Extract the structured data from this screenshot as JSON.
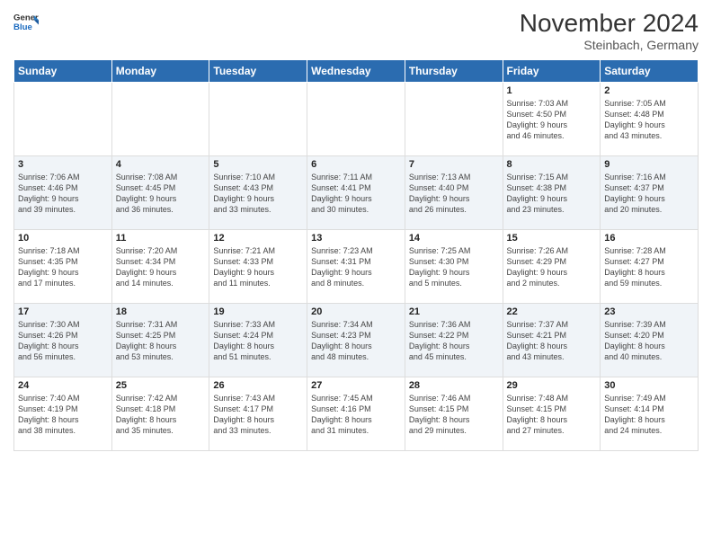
{
  "header": {
    "logo_line1": "General",
    "logo_line2": "Blue",
    "month_title": "November 2024",
    "subtitle": "Steinbach, Germany"
  },
  "weekdays": [
    "Sunday",
    "Monday",
    "Tuesday",
    "Wednesday",
    "Thursday",
    "Friday",
    "Saturday"
  ],
  "weeks": [
    [
      {
        "day": "",
        "info": ""
      },
      {
        "day": "",
        "info": ""
      },
      {
        "day": "",
        "info": ""
      },
      {
        "day": "",
        "info": ""
      },
      {
        "day": "",
        "info": ""
      },
      {
        "day": "1",
        "info": "Sunrise: 7:03 AM\nSunset: 4:50 PM\nDaylight: 9 hours\nand 46 minutes."
      },
      {
        "day": "2",
        "info": "Sunrise: 7:05 AM\nSunset: 4:48 PM\nDaylight: 9 hours\nand 43 minutes."
      }
    ],
    [
      {
        "day": "3",
        "info": "Sunrise: 7:06 AM\nSunset: 4:46 PM\nDaylight: 9 hours\nand 39 minutes."
      },
      {
        "day": "4",
        "info": "Sunrise: 7:08 AM\nSunset: 4:45 PM\nDaylight: 9 hours\nand 36 minutes."
      },
      {
        "day": "5",
        "info": "Sunrise: 7:10 AM\nSunset: 4:43 PM\nDaylight: 9 hours\nand 33 minutes."
      },
      {
        "day": "6",
        "info": "Sunrise: 7:11 AM\nSunset: 4:41 PM\nDaylight: 9 hours\nand 30 minutes."
      },
      {
        "day": "7",
        "info": "Sunrise: 7:13 AM\nSunset: 4:40 PM\nDaylight: 9 hours\nand 26 minutes."
      },
      {
        "day": "8",
        "info": "Sunrise: 7:15 AM\nSunset: 4:38 PM\nDaylight: 9 hours\nand 23 minutes."
      },
      {
        "day": "9",
        "info": "Sunrise: 7:16 AM\nSunset: 4:37 PM\nDaylight: 9 hours\nand 20 minutes."
      }
    ],
    [
      {
        "day": "10",
        "info": "Sunrise: 7:18 AM\nSunset: 4:35 PM\nDaylight: 9 hours\nand 17 minutes."
      },
      {
        "day": "11",
        "info": "Sunrise: 7:20 AM\nSunset: 4:34 PM\nDaylight: 9 hours\nand 14 minutes."
      },
      {
        "day": "12",
        "info": "Sunrise: 7:21 AM\nSunset: 4:33 PM\nDaylight: 9 hours\nand 11 minutes."
      },
      {
        "day": "13",
        "info": "Sunrise: 7:23 AM\nSunset: 4:31 PM\nDaylight: 9 hours\nand 8 minutes."
      },
      {
        "day": "14",
        "info": "Sunrise: 7:25 AM\nSunset: 4:30 PM\nDaylight: 9 hours\nand 5 minutes."
      },
      {
        "day": "15",
        "info": "Sunrise: 7:26 AM\nSunset: 4:29 PM\nDaylight: 9 hours\nand 2 minutes."
      },
      {
        "day": "16",
        "info": "Sunrise: 7:28 AM\nSunset: 4:27 PM\nDaylight: 8 hours\nand 59 minutes."
      }
    ],
    [
      {
        "day": "17",
        "info": "Sunrise: 7:30 AM\nSunset: 4:26 PM\nDaylight: 8 hours\nand 56 minutes."
      },
      {
        "day": "18",
        "info": "Sunrise: 7:31 AM\nSunset: 4:25 PM\nDaylight: 8 hours\nand 53 minutes."
      },
      {
        "day": "19",
        "info": "Sunrise: 7:33 AM\nSunset: 4:24 PM\nDaylight: 8 hours\nand 51 minutes."
      },
      {
        "day": "20",
        "info": "Sunrise: 7:34 AM\nSunset: 4:23 PM\nDaylight: 8 hours\nand 48 minutes."
      },
      {
        "day": "21",
        "info": "Sunrise: 7:36 AM\nSunset: 4:22 PM\nDaylight: 8 hours\nand 45 minutes."
      },
      {
        "day": "22",
        "info": "Sunrise: 7:37 AM\nSunset: 4:21 PM\nDaylight: 8 hours\nand 43 minutes."
      },
      {
        "day": "23",
        "info": "Sunrise: 7:39 AM\nSunset: 4:20 PM\nDaylight: 8 hours\nand 40 minutes."
      }
    ],
    [
      {
        "day": "24",
        "info": "Sunrise: 7:40 AM\nSunset: 4:19 PM\nDaylight: 8 hours\nand 38 minutes."
      },
      {
        "day": "25",
        "info": "Sunrise: 7:42 AM\nSunset: 4:18 PM\nDaylight: 8 hours\nand 35 minutes."
      },
      {
        "day": "26",
        "info": "Sunrise: 7:43 AM\nSunset: 4:17 PM\nDaylight: 8 hours\nand 33 minutes."
      },
      {
        "day": "27",
        "info": "Sunrise: 7:45 AM\nSunset: 4:16 PM\nDaylight: 8 hours\nand 31 minutes."
      },
      {
        "day": "28",
        "info": "Sunrise: 7:46 AM\nSunset: 4:15 PM\nDaylight: 8 hours\nand 29 minutes."
      },
      {
        "day": "29",
        "info": "Sunrise: 7:48 AM\nSunset: 4:15 PM\nDaylight: 8 hours\nand 27 minutes."
      },
      {
        "day": "30",
        "info": "Sunrise: 7:49 AM\nSunset: 4:14 PM\nDaylight: 8 hours\nand 24 minutes."
      }
    ]
  ]
}
